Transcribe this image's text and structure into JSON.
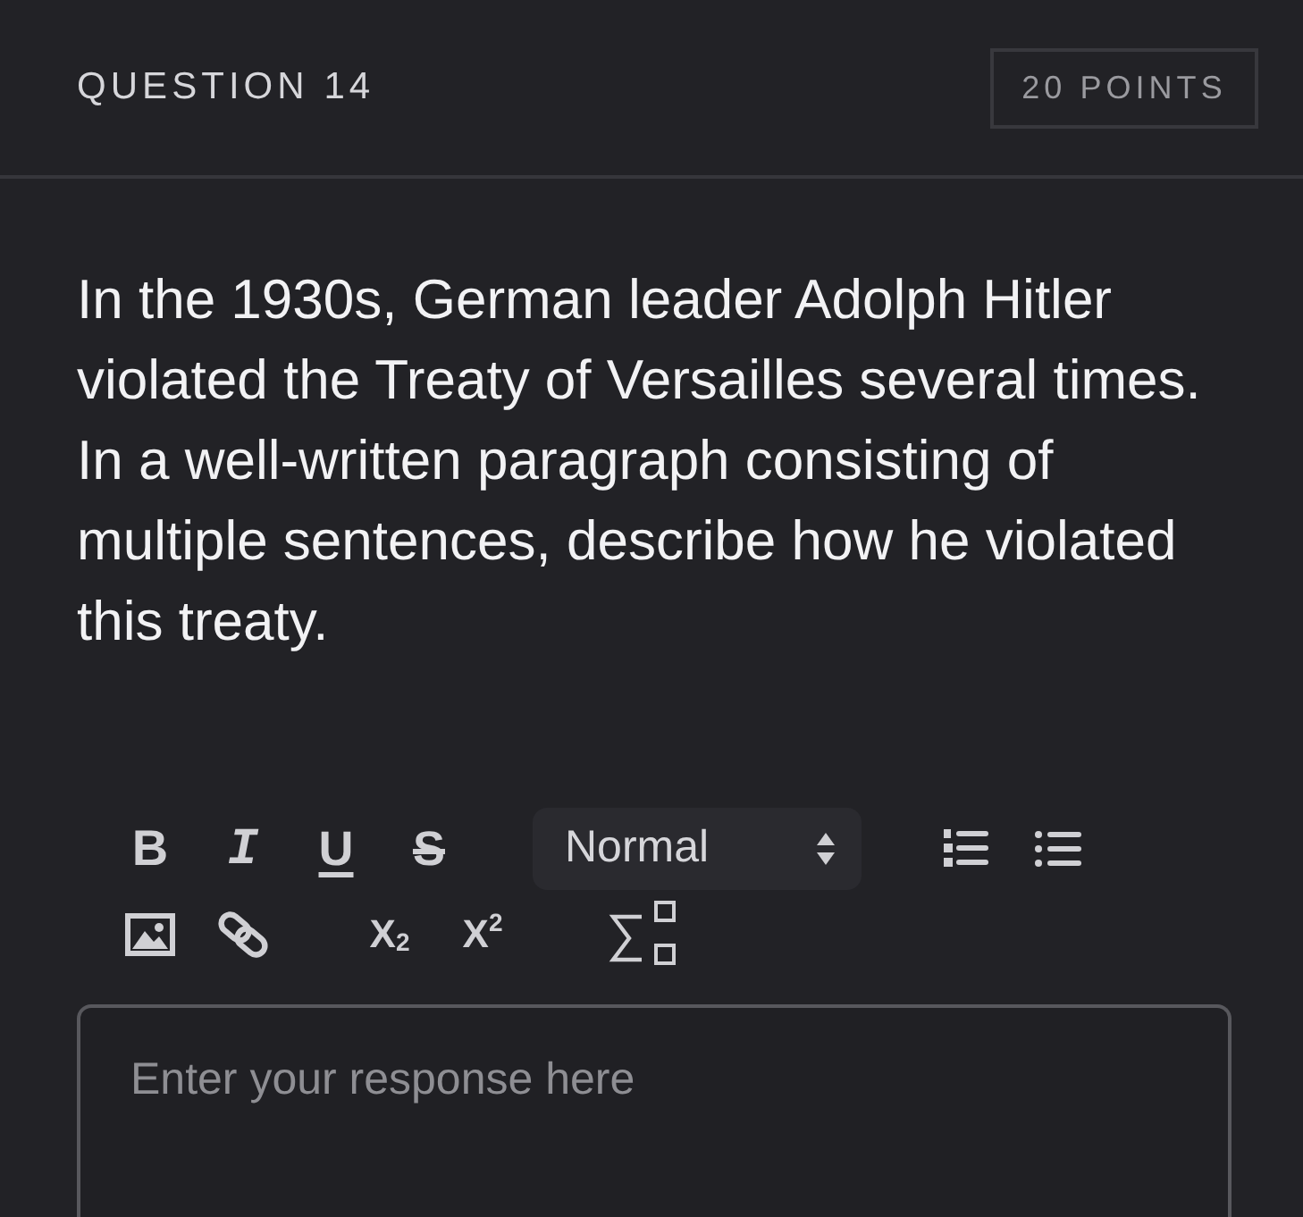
{
  "header": {
    "title": "QUESTION 14",
    "points": "20 POINTS"
  },
  "prompt": "In the 1930s, German leader Adolph Hitler violated the Treaty of Versailles several times. In a well-written paragraph consisting of multiple sentences, describe how he violated this treaty.",
  "toolbar": {
    "rows": [
      [
        {
          "kind": "bold",
          "label": "B"
        },
        {
          "kind": "italic",
          "label": "I"
        },
        {
          "kind": "underline",
          "label": "U"
        },
        {
          "kind": "strike",
          "label": "S"
        },
        {
          "kind": "select",
          "value": "Normal"
        },
        {
          "kind": "ordered-list"
        },
        {
          "kind": "bullet-list"
        }
      ],
      [
        {
          "kind": "image"
        },
        {
          "kind": "link"
        },
        {
          "kind": "subscript",
          "label": "X$_{2}$"
        },
        {
          "kind": "superscript",
          "label": "X$^{2}$"
        },
        {
          "kind": "formula"
        }
      ]
    ]
  },
  "response": {
    "placeholder": "Enter your response here"
  }
}
